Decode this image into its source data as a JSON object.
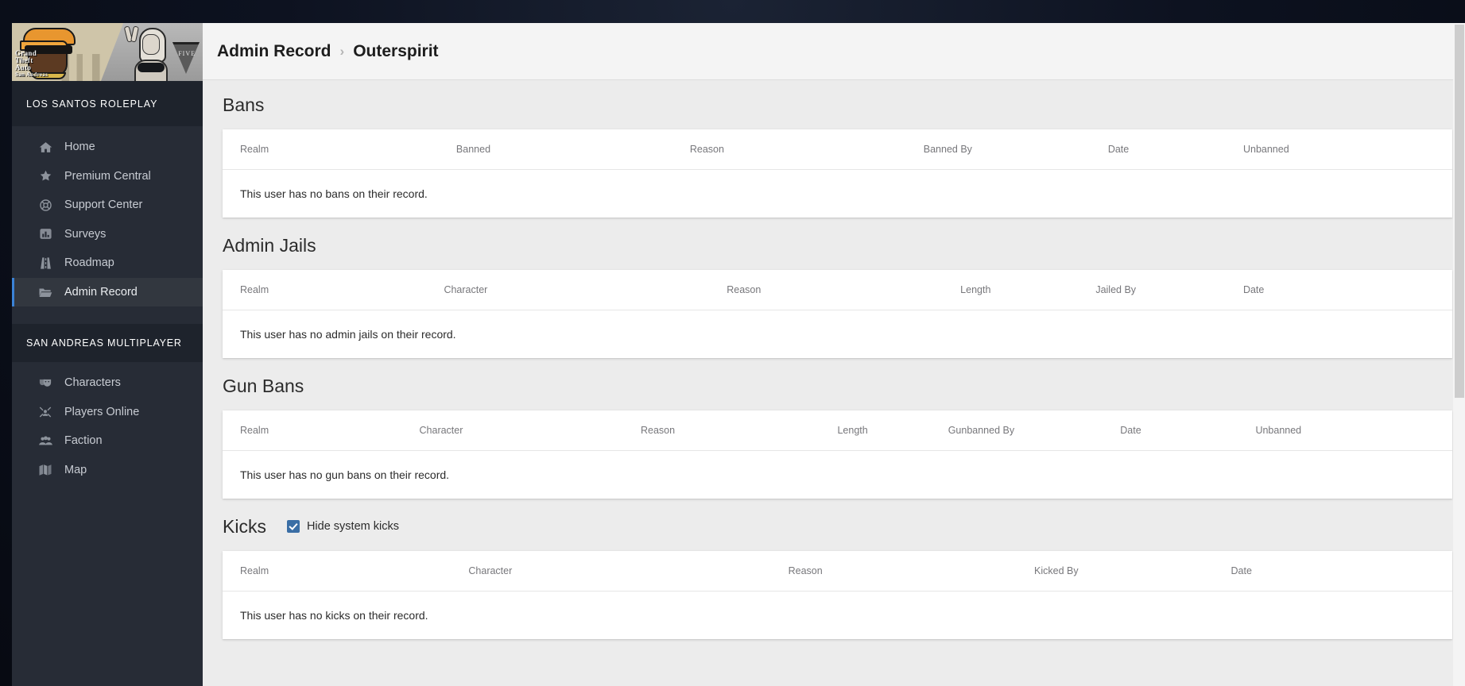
{
  "app": {
    "sidebar_title": "LOS SANTOS ROLEPLAY",
    "banner_logo_line1": "Grand",
    "banner_logo_line2": "Theft",
    "banner_logo_line3": "Auto",
    "banner_logo_line4": "San Andreas",
    "banner_v_label": "FIVE",
    "accent_color": "#3b82d6",
    "checkbox_color": "#3a6ea5"
  },
  "sidebar": {
    "groups": [
      {
        "section_label": null,
        "items": [
          {
            "label": "Home",
            "icon": "home-icon",
            "active": false
          },
          {
            "label": "Premium Central",
            "icon": "star-icon",
            "active": false
          },
          {
            "label": "Support Center",
            "icon": "lifebuoy-icon",
            "active": false
          },
          {
            "label": "Surveys",
            "icon": "chart-bar-icon",
            "active": false
          },
          {
            "label": "Roadmap",
            "icon": "road-icon",
            "active": false
          },
          {
            "label": "Admin Record",
            "icon": "folder-open-icon",
            "active": true
          }
        ]
      },
      {
        "section_label": "SAN ANDREAS MULTIPLAYER",
        "items": [
          {
            "label": "Characters",
            "icon": "masks-icon",
            "active": false
          },
          {
            "label": "Players Online",
            "icon": "users-crosshair-icon",
            "active": false
          },
          {
            "label": "Faction",
            "icon": "user-group-icon",
            "active": false
          },
          {
            "label": "Map",
            "icon": "map-icon",
            "active": false
          }
        ]
      }
    ]
  },
  "breadcrumb": {
    "root": "Admin Record",
    "separator": "›",
    "current": "Outerspirit"
  },
  "sections": [
    {
      "id": "bans",
      "title": "Bans",
      "checkbox": null,
      "columns": [
        "Realm",
        "Banned",
        "Reason",
        "Banned By",
        "Date",
        "Unbanned"
      ],
      "col_widths": [
        "19%",
        "19%",
        "19%",
        "15%",
        "11%",
        "17%"
      ],
      "rows": [],
      "empty_message": "This user has no bans on their record."
    },
    {
      "id": "admin-jails",
      "title": "Admin Jails",
      "checkbox": null,
      "columns": [
        "Realm",
        "Character",
        "Reason",
        "Length",
        "Jailed By",
        "Date"
      ],
      "col_widths": [
        "18%",
        "23%",
        "19%",
        "11%",
        "12%",
        "17%"
      ],
      "rows": [],
      "empty_message": "This user has no admin jails on their record."
    },
    {
      "id": "gun-bans",
      "title": "Gun Bans",
      "checkbox": null,
      "columns": [
        "Realm",
        "Character",
        "Reason",
        "Length",
        "Gunbanned By",
        "Date",
        "Unbanned"
      ],
      "col_widths": [
        "16%",
        "18%",
        "16%",
        "9%",
        "14%",
        "11%",
        "16%"
      ],
      "rows": [],
      "empty_message": "This user has no gun bans on their record."
    },
    {
      "id": "kicks",
      "title": "Kicks",
      "checkbox": {
        "label": "Hide system kicks",
        "checked": true
      },
      "columns": [
        "Realm",
        "Character",
        "Reason",
        "Kicked By",
        "Date"
      ],
      "col_widths": [
        "20%",
        "26%",
        "20%",
        "16%",
        "18%"
      ],
      "rows": [],
      "empty_message": "This user has no kicks on their record."
    }
  ]
}
